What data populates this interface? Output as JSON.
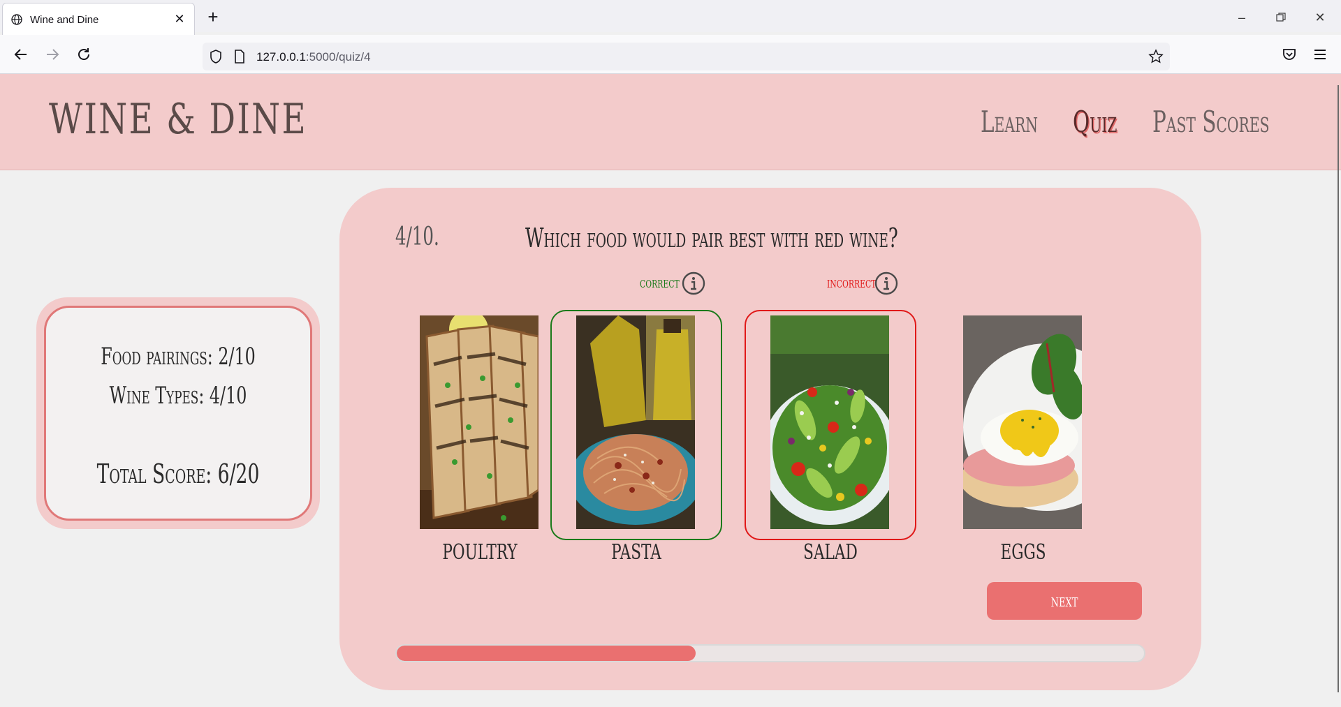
{
  "browser": {
    "tab_title": "Wine and Dine",
    "url_host": "127.0.0.1",
    "url_path": ":5000/quiz/4"
  },
  "site": {
    "logo": "WINE & DINE",
    "nav": [
      {
        "label": "Learn",
        "active": false
      },
      {
        "label": "Quiz",
        "active": true
      },
      {
        "label": "Past Scores",
        "active": false
      }
    ]
  },
  "score": {
    "food_pairings": "Food pairings:  2/10",
    "wine_types": "Wine Types:  4/10",
    "total": "Total Score:  6/20"
  },
  "quiz": {
    "number": "4/10.",
    "question": "Which food would pair best with red wine?",
    "feedback_correct": "correct",
    "feedback_incorrect": "incorrect",
    "options": [
      {
        "label": "POULTRY",
        "state": "none"
      },
      {
        "label": "PASTA",
        "state": "correct"
      },
      {
        "label": "SALAD",
        "state": "incorrect"
      },
      {
        "label": "EGGS",
        "state": "none"
      }
    ],
    "next_label": "next",
    "progress": 0.4
  },
  "colors": {
    "header_bg": "#f3cbcb",
    "accent": "#ea7070",
    "correct": "#1a7a1a",
    "incorrect": "#e01818"
  }
}
